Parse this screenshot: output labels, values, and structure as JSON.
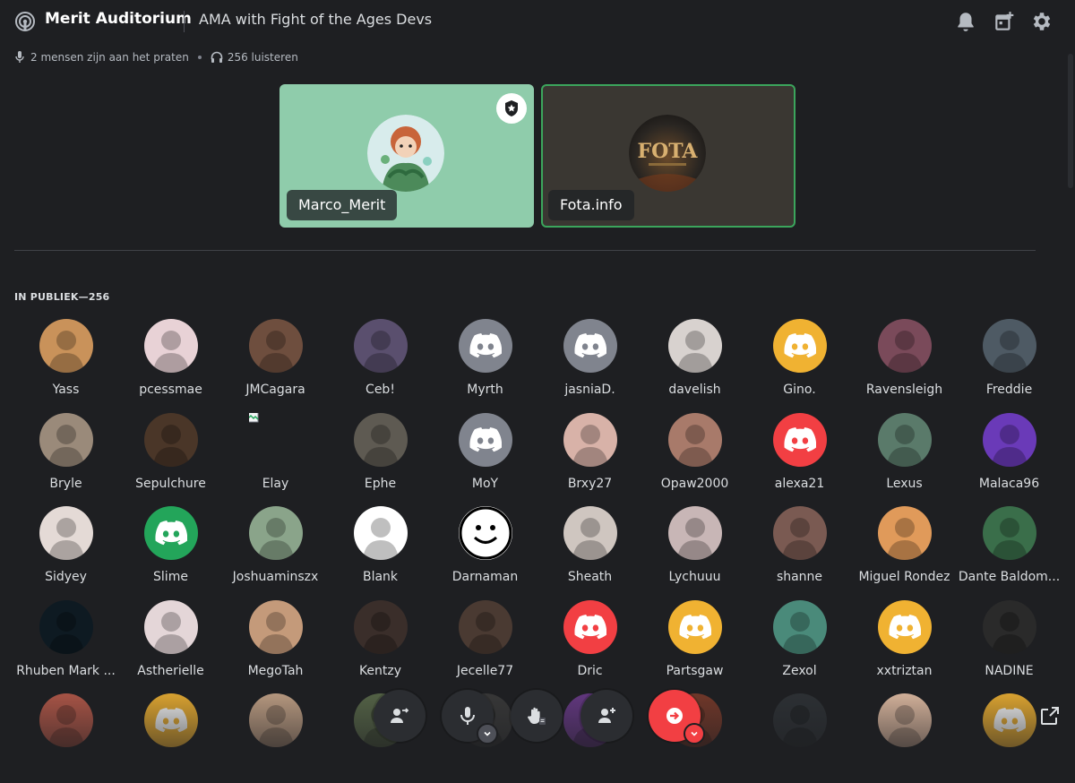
{
  "header": {
    "channel_name": "Merit Auditorium",
    "topic": "AMA with Fight of the Ages Devs",
    "speaking_text": "2 mensen zijn aan het praten",
    "listeners_text": "256 luisteren"
  },
  "speakers": [
    {
      "name": "Marco_Merit",
      "moderator": true
    },
    {
      "name": "Fota.info",
      "speaking": true
    }
  ],
  "audience": {
    "label": "IN PUBLIEK—256",
    "members": [
      {
        "name": "Yass",
        "color": "#c9925a"
      },
      {
        "name": "pcessmae",
        "color": "#e8d2d6"
      },
      {
        "name": "JMCagara",
        "color": "#6e4e3e"
      },
      {
        "name": "Ceb!",
        "color": "#5a4f6e"
      },
      {
        "name": "Myrth",
        "color": "#80848e",
        "icon": "discord-icon"
      },
      {
        "name": "jasniaD.",
        "color": "#80848e",
        "icon": "discord-icon"
      },
      {
        "name": "davelish",
        "color": "#d8d2cf"
      },
      {
        "name": "Gino.",
        "color": "#f0b232",
        "icon": "discord-icon"
      },
      {
        "name": "Ravensleigh",
        "color": "#7a4a5a"
      },
      {
        "name": "Freddie",
        "color": "#4e5a64"
      },
      {
        "name": "Bryle",
        "color": "#9a8a7a"
      },
      {
        "name": "Sepulchure",
        "color": "#4a3628"
      },
      {
        "name": "Elay",
        "color": "#1e1f22",
        "broken": true
      },
      {
        "name": "Ephe",
        "color": "#5e5a52"
      },
      {
        "name": "MoY",
        "color": "#80848e",
        "icon": "discord-icon"
      },
      {
        "name": "Brxy27",
        "color": "#d8b2a8"
      },
      {
        "name": "Opaw2000",
        "color": "#a87a6a"
      },
      {
        "name": "alexa21",
        "color": "#f23f43",
        "icon": "discord-icon"
      },
      {
        "name": "Lexus",
        "color": "#5a7a6a"
      },
      {
        "name": "Malaca96",
        "color": "#6a3ab8"
      },
      {
        "name": "Sidyey",
        "color": "#e4dad6"
      },
      {
        "name": "Slime",
        "color": "#23a55a",
        "icon": "discord-icon"
      },
      {
        "name": "Joshuaminszx",
        "color": "#8aa48a"
      },
      {
        "name": "Blank",
        "color": "#ffffff"
      },
      {
        "name": "Darnaman",
        "color": "#ffffff",
        "icon": "smiley-icon"
      },
      {
        "name": "Sheath",
        "color": "#cfc6c0"
      },
      {
        "name": "Lychuuu",
        "color": "#c8b6b6"
      },
      {
        "name": "shanne",
        "color": "#7a5a52"
      },
      {
        "name": "Miguel Rondez",
        "color": "#e09a5a"
      },
      {
        "name": "Dante Baldom...",
        "color": "#3a6e4a"
      },
      {
        "name": "Rhuben Mark ...",
        "color": "#0e1a22"
      },
      {
        "name": "Astherielle",
        "color": "#e4d6d8"
      },
      {
        "name": "MegoTah",
        "color": "#c49a7a"
      },
      {
        "name": "Kentzy",
        "color": "#3a2e2a"
      },
      {
        "name": "Jecelle77",
        "color": "#4a3a32"
      },
      {
        "name": "Dric",
        "color": "#f23f43",
        "icon": "discord-icon"
      },
      {
        "name": "Partsgaw",
        "color": "#f0b232",
        "icon": "discord-icon"
      },
      {
        "name": "Zexol",
        "color": "#4a8a7a"
      },
      {
        "name": "xxtriztan",
        "color": "#f0b232",
        "icon": "discord-icon"
      },
      {
        "name": "NADINE",
        "color": "#2a2a2a"
      },
      {
        "name": "",
        "color": "#b85a4a"
      },
      {
        "name": "",
        "color": "#f0b232",
        "icon": "discord-icon"
      },
      {
        "name": "",
        "color": "#c8a68a"
      },
      {
        "name": "",
        "color": "#5a6a4a"
      },
      {
        "name": "",
        "color": "#3a3a3a"
      },
      {
        "name": "",
        "color": "#6a3a8a"
      },
      {
        "name": "",
        "color": "#7a3a2a"
      },
      {
        "name": "",
        "color": "#2e3236"
      },
      {
        "name": "",
        "color": "#e8c2a8"
      },
      {
        "name": "",
        "color": "#f0b232",
        "icon": "discord-icon"
      }
    ]
  },
  "controls": [
    "invite-to-speak-icon",
    "microphone-icon",
    "raise-hand-icon",
    "add-user-icon",
    "leave-icon"
  ],
  "colors": {
    "accent_green": "#3ba55c",
    "danger": "#f23f43",
    "bg": "#1e1f22"
  }
}
